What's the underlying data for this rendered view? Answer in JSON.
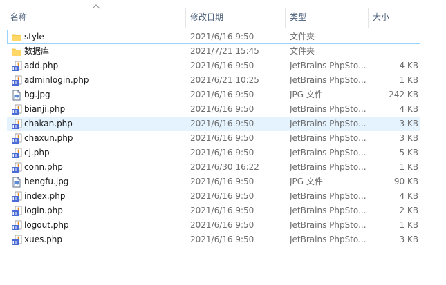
{
  "columns": {
    "name": "名称",
    "date": "修改日期",
    "type": "类型",
    "size": "大小"
  },
  "files": [
    {
      "name": "style",
      "date": "2021/6/16 9:50",
      "type": "文件夹",
      "size": "",
      "icon": "folder-icon"
    },
    {
      "name": "数据库",
      "date": "2021/7/21 15:45",
      "type": "文件夹",
      "size": "",
      "icon": "folder-icon"
    },
    {
      "name": "add.php",
      "date": "2021/6/16 9:50",
      "type": "JetBrains PhpSto...",
      "size": "4 KB",
      "icon": "php-file-icon"
    },
    {
      "name": "adminlogin.php",
      "date": "2021/6/21 10:25",
      "type": "JetBrains PhpSto...",
      "size": "1 KB",
      "icon": "php-file-icon"
    },
    {
      "name": "bg.jpg",
      "date": "2021/6/16 9:50",
      "type": "JPG 文件",
      "size": "242 KB",
      "icon": "image-file-icon"
    },
    {
      "name": "bianji.php",
      "date": "2021/6/16 9:50",
      "type": "JetBrains PhpSto...",
      "size": "4 KB",
      "icon": "php-file-icon"
    },
    {
      "name": "chakan.php",
      "date": "2021/6/16 9:50",
      "type": "JetBrains PhpSto...",
      "size": "3 KB",
      "icon": "php-file-icon"
    },
    {
      "name": "chaxun.php",
      "date": "2021/6/16 9:50",
      "type": "JetBrains PhpSto...",
      "size": "3 KB",
      "icon": "php-file-icon"
    },
    {
      "name": "cj.php",
      "date": "2021/6/16 9:50",
      "type": "JetBrains PhpSto...",
      "size": "5 KB",
      "icon": "php-file-icon"
    },
    {
      "name": "conn.php",
      "date": "2021/6/30 16:22",
      "type": "JetBrains PhpSto...",
      "size": "1 KB",
      "icon": "php-file-icon"
    },
    {
      "name": "hengfu.jpg",
      "date": "2021/6/16 9:50",
      "type": "JPG 文件",
      "size": "90 KB",
      "icon": "image-file-icon"
    },
    {
      "name": "index.php",
      "date": "2021/6/16 9:50",
      "type": "JetBrains PhpSto...",
      "size": "4 KB",
      "icon": "php-file-icon"
    },
    {
      "name": "login.php",
      "date": "2021/6/16 9:50",
      "type": "JetBrains PhpSto...",
      "size": "2 KB",
      "icon": "php-file-icon"
    },
    {
      "name": "logout.php",
      "date": "2021/6/16 9:50",
      "type": "JetBrains PhpSto...",
      "size": "1 KB",
      "icon": "php-file-icon"
    },
    {
      "name": "xues.php",
      "date": "2021/6/16 9:50",
      "type": "JetBrains PhpSto...",
      "size": "3 KB",
      "icon": "php-file-icon"
    }
  ],
  "selected_index": 0,
  "hover_index": 6,
  "colors": {
    "header_text": "#4c607a",
    "selected_border": "#99d1ff",
    "hover_bg": "#e5f3ff",
    "folder": "#f5c84c",
    "php_badge": "#4a6bd6"
  }
}
